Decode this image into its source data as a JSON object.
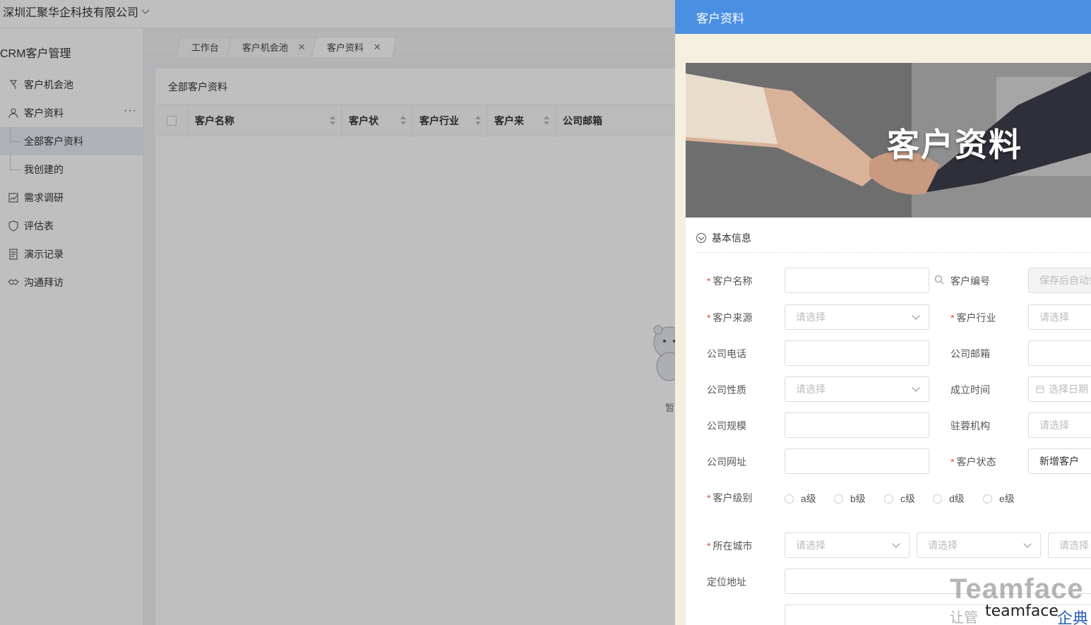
{
  "app": {
    "company": "深圳汇聚华企科技有限公司",
    "module_title": "CRM客户管理"
  },
  "sidebar": {
    "items": [
      {
        "label": "客户机会池",
        "icon": "opportunity-icon"
      },
      {
        "label": "客户资料",
        "icon": "user-icon",
        "more": "···"
      },
      {
        "label": "全部客户资料",
        "sub": true,
        "active": true
      },
      {
        "label": "我创建的",
        "sub": true
      },
      {
        "label": "需求调研",
        "icon": "survey-icon"
      },
      {
        "label": "评估表",
        "icon": "shield-icon"
      },
      {
        "label": "演示记录",
        "icon": "document-icon"
      },
      {
        "label": "沟通拜访",
        "icon": "handshake-icon"
      }
    ]
  },
  "tabs": [
    {
      "label": "工作台",
      "closable": false
    },
    {
      "label": "客户机会池",
      "closable": true
    },
    {
      "label": "客户资料",
      "closable": true,
      "active": true
    }
  ],
  "main": {
    "title": "全部客户资料",
    "columns": [
      "客户名称",
      "客户状",
      "客户行业",
      "客户来",
      "公司邮箱"
    ],
    "empty_text": "暂"
  },
  "drawer": {
    "title": "客户资料",
    "banner_text": "客户资料",
    "section": "基本信息",
    "fields": {
      "customer_name": {
        "label": "客户名称",
        "required": true,
        "value": ""
      },
      "customer_no": {
        "label": "客户编号",
        "placeholder": "保存后自动生成"
      },
      "source": {
        "label": "客户来源",
        "required": true,
        "placeholder": "请选择"
      },
      "industry": {
        "label": "客户行业",
        "required": true,
        "placeholder": "请选择"
      },
      "phone": {
        "label": "公司电话",
        "value": ""
      },
      "email": {
        "label": "公司邮箱",
        "value": ""
      },
      "nature": {
        "label": "公司性质",
        "placeholder": "请选择"
      },
      "founded": {
        "label": "成立时间",
        "placeholder": "选择日期"
      },
      "scale": {
        "label": "公司规模",
        "value": ""
      },
      "agency": {
        "label": "驻蓉机构",
        "placeholder": "请选择"
      },
      "website": {
        "label": "公司网址",
        "value": ""
      },
      "status": {
        "label": "客户状态",
        "required": true,
        "value": "新增客户"
      },
      "level": {
        "label": "客户级别",
        "required": true,
        "options": [
          "a级",
          "b级",
          "c级",
          "d级",
          "e级"
        ]
      },
      "city": {
        "label": "所在城市",
        "required": true,
        "placeholders": [
          "请选择",
          "请选择",
          "请选择"
        ]
      },
      "address": {
        "label": "定位地址",
        "value": ""
      }
    }
  },
  "watermark": {
    "brand": "Teamface",
    "slogan": "让管",
    "logo": "teamface",
    "logo_cn": "企典"
  },
  "colors": {
    "header_blue": "#4a90e2",
    "required_red": "#e74c3c",
    "drawer_bg": "#f5efe0"
  }
}
